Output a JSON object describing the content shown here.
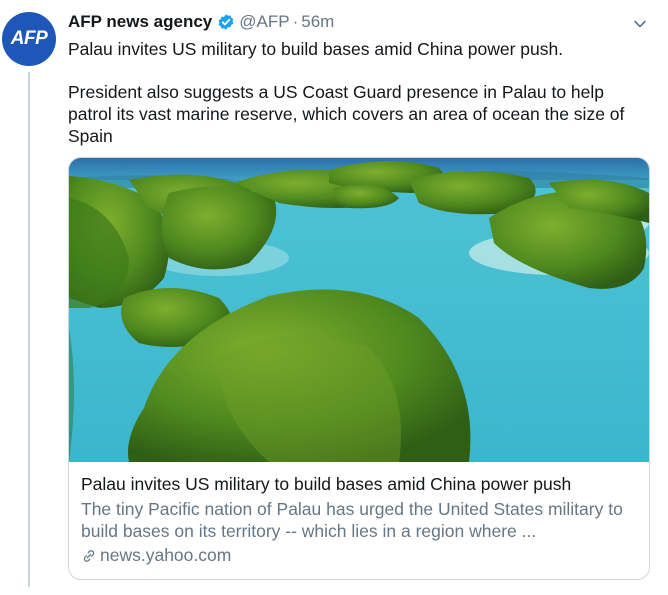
{
  "tweet": {
    "avatar_text": "AFP",
    "author": "AFP news agency",
    "handle": "@AFP",
    "separator": "·",
    "time": "56m",
    "text_line1": "Palau invites US military to build bases amid China power push.",
    "text_paragraph2": "President also suggests a US Coast Guard presence in Palau to help patrol its vast marine reserve, which covers an area of ocean the size of Spain"
  },
  "card": {
    "title": "Palau invites US military to build bases amid China power push",
    "description": "The tiny Pacific nation of Palau has urged the United States military to build bases on its territory -- which lies in a region where ...",
    "domain": "news.yahoo.com"
  },
  "icons": {
    "verified": "verified-badge-icon",
    "caret": "chevron-down-icon",
    "link": "link-icon"
  },
  "colors": {
    "avatar_bg": "#1f57b8",
    "verified": "#1da1f2",
    "secondary_text": "#657786",
    "border": "#ccd6dd"
  }
}
